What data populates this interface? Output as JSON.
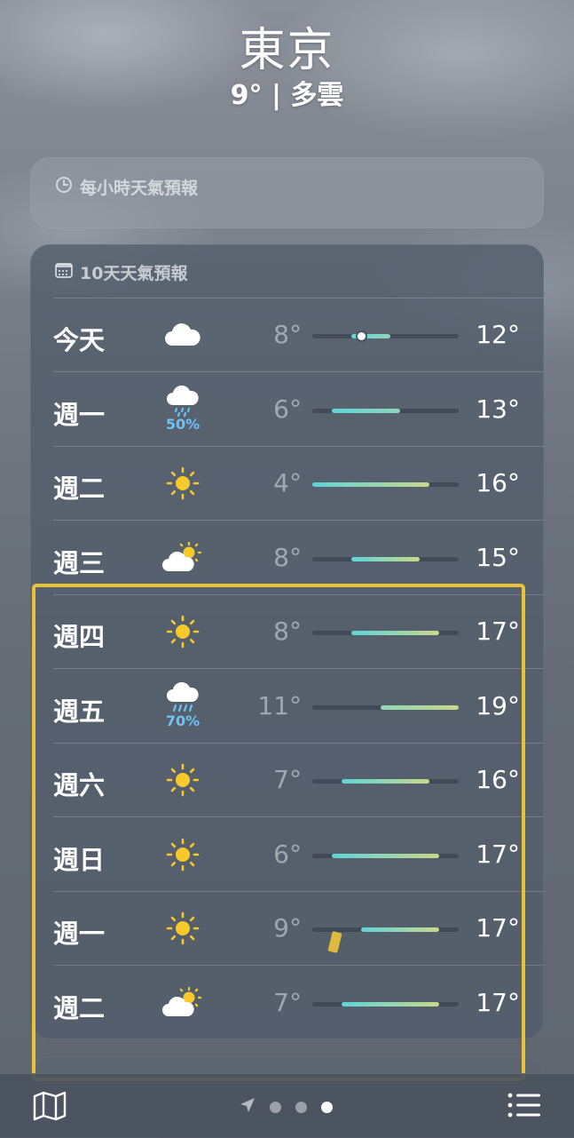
{
  "header": {
    "city": "東京",
    "summary": "9° | 多雲"
  },
  "hourly_card": {
    "title": "每小時天氣預報",
    "icon": "clock-icon"
  },
  "daily_card": {
    "title": "10天天氣預報",
    "icon": "calendar-icon",
    "scale_min": 4,
    "scale_max": 19,
    "current_temp": 9,
    "days": [
      {
        "day": "今天",
        "icon": "cloud-icon",
        "precip": "",
        "low": "8°",
        "high": "12°",
        "low_v": 8,
        "high_v": 12
      },
      {
        "day": "週一",
        "icon": "cloud-rain-icon",
        "precip": "50%",
        "low": "6°",
        "high": "13°",
        "low_v": 6,
        "high_v": 13
      },
      {
        "day": "週二",
        "icon": "sun-icon",
        "precip": "",
        "low": "4°",
        "high": "16°",
        "low_v": 4,
        "high_v": 16
      },
      {
        "day": "週三",
        "icon": "partly-cloudy-icon",
        "precip": "",
        "low": "8°",
        "high": "15°",
        "low_v": 8,
        "high_v": 15
      },
      {
        "day": "週四",
        "icon": "sun-icon",
        "precip": "",
        "low": "8°",
        "high": "17°",
        "low_v": 8,
        "high_v": 17
      },
      {
        "day": "週五",
        "icon": "cloud-heavy-rain-icon",
        "precip": "70%",
        "low": "11°",
        "high": "19°",
        "low_v": 11,
        "high_v": 19
      },
      {
        "day": "週六",
        "icon": "sun-icon",
        "precip": "",
        "low": "7°",
        "high": "16°",
        "low_v": 7,
        "high_v": 16
      },
      {
        "day": "週日",
        "icon": "sun-icon",
        "precip": "",
        "low": "6°",
        "high": "17°",
        "low_v": 6,
        "high_v": 17
      },
      {
        "day": "週一",
        "icon": "sun-icon",
        "precip": "",
        "low": "9°",
        "high": "17°",
        "low_v": 9,
        "high_v": 17
      },
      {
        "day": "週二",
        "icon": "partly-cloudy-icon",
        "precip": "",
        "low": "7°",
        "high": "17°",
        "low_v": 7,
        "high_v": 17
      }
    ]
  },
  "toolbar": {
    "map_icon": "map-icon",
    "location_icon": "location-arrow-icon",
    "list_icon": "list-icon",
    "pages": 3,
    "active_page": 3
  },
  "colors": {
    "cool": "#5fd3d8",
    "mild": "#8fd6b8",
    "warm": "#c7d98a",
    "highlight": "#e8c33a",
    "precip": "#6cc3f5"
  }
}
